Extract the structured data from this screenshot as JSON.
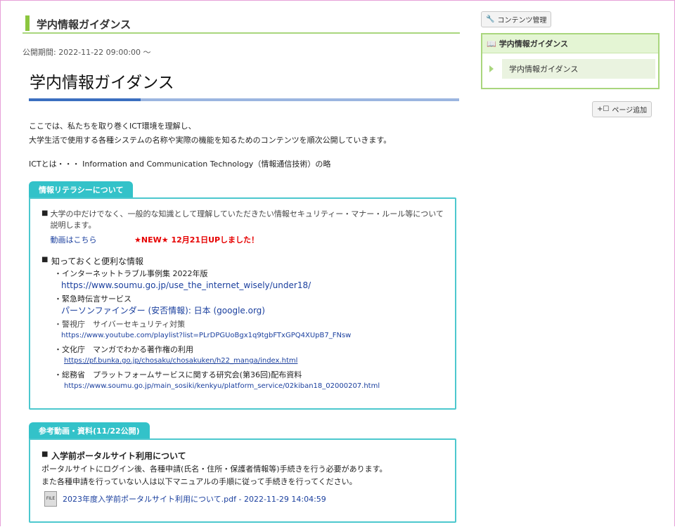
{
  "page": {
    "header_title": "学内情報ガイダンス",
    "published": "公開期間: 2022-11-22 09:00:00 ～",
    "main_title": "学内情報ガイダンス",
    "intro_line1": "ここでは、私たちを取り巻くICT環境を理解し、",
    "intro_line2": "大学生活で使用する各種システムの名称や実際の機能を知るためのコンテンツを順次公開していきます。",
    "ict_note": "ICTとは・・・ Information and Communication Technology（情報通信技術）の略"
  },
  "section1": {
    "tab": "情報リテラシーについて",
    "item1_text": "大学の中だけでなく、一般的な知識として理解していただきたい情報セキュリティー・マナー・ルール等について説明します。",
    "video_link": "動画はこちら",
    "new_note": "★NEW★ 12月21日UPしました！",
    "item2_title": "知っておくと便利な情報",
    "links": [
      {
        "label": "・インターネットトラブル事例集 2022年版",
        "url": "https://www.soumu.go.jp/use_the_internet_wisely/under18/"
      },
      {
        "label": "・緊急時伝言サービス",
        "url": "パーソンファインダー (安否情報): 日本 (google.org)"
      },
      {
        "label": "・警視庁　サイバーセキュリティ対策",
        "url": "https://www.youtube.com/playlist?list=PLrDPGUoBgx1q9tgbFTxGPQ4XUpB7_FNsw"
      },
      {
        "label": "・文化庁　マンガでわかる著作権の利用",
        "url": "https://pf.bunka.go.jp/chosaku/chosakuken/h22_manga/index.html"
      },
      {
        "label": "・総務省　プラットフォームサービスに関する研究会(第36回)配布資料",
        "url": "https://www.soumu.go.jp/main_sosiki/kenkyu/platform_service/02kiban18_02000207.html"
      }
    ]
  },
  "section2": {
    "tab": "参考動画・資料(11/22公開)",
    "item_title": "入学前ポータルサイト利用について",
    "text1": "ポータルサイトにログイン後、各種申請(氏名・住所・保護者情報等)手続きを行う必要があります。",
    "text2": "また各種申請を行っていない人は以下マニュアルの手順に従って手続きを行ってください。",
    "file_label": "FILE",
    "file_name": "2023年度入学前ポータルサイト利用について.pdf - 2022-11-29 14:04:59"
  },
  "sidebar": {
    "manage_button": "コンテンツ管理",
    "panel_title": "学内情報ガイダンス",
    "panel_item": "学内情報ガイダンス",
    "add_page_button": "ページ追加"
  }
}
